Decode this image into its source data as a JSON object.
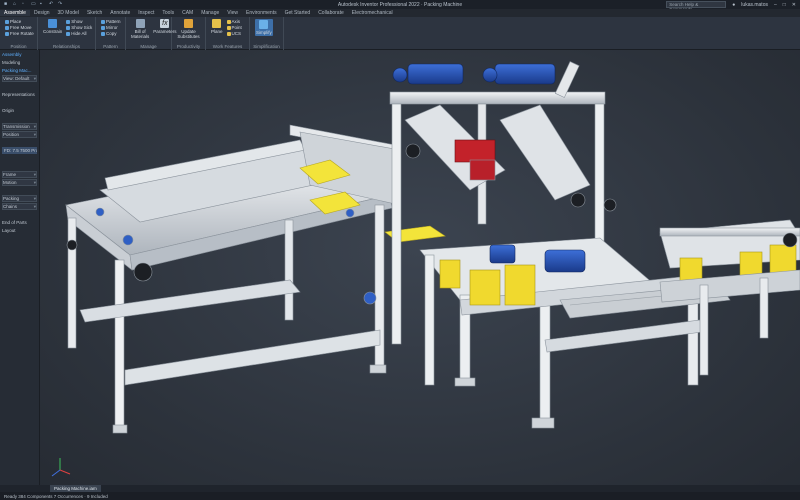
{
  "window": {
    "title": "Autodesk Inventor Professional 2022  ·  Packing Machine"
  },
  "search": {
    "placeholder": "Search Help & Commands..."
  },
  "user": {
    "name": "lukas.matos"
  },
  "tabs": [
    "Assemble",
    "Design",
    "3D Model",
    "Sketch",
    "Annotate",
    "Inspect",
    "Tools",
    "CAM",
    "Manage",
    "View",
    "Environments",
    "Get Started",
    "Collaborate",
    "Electromechanical"
  ],
  "ribbon": {
    "place": {
      "items": [
        "Place",
        "Free Move",
        "Free Rotate"
      ],
      "title": "Position"
    },
    "constrain": {
      "label": "Constrain",
      "items": [
        "Show",
        "Show Sick",
        "Hide All"
      ],
      "title": "Relationships"
    },
    "pattern": {
      "items": [
        "Pattern",
        "Mirror",
        "Copy"
      ],
      "title": "Pattern"
    },
    "manage": {
      "bom": "Bill of Materials",
      "params": "Parameters",
      "title": "Manage"
    },
    "productivity": {
      "substitutes": "Update Substitutes",
      "title": "Productivity"
    },
    "workfeatures": {
      "plane": "Plane",
      "items": [
        "Axis",
        "Point",
        "UCS"
      ],
      "title": "Work Features"
    },
    "simplification": {
      "simplify": "Simplify",
      "title": "Simplification"
    }
  },
  "browser": {
    "rows": [
      "Assembly",
      "Modeling",
      "Packing Mac...",
      "View: Default",
      "",
      "Representations",
      "",
      "Origin",
      "",
      "Transmission",
      "Position",
      "",
      "FD: 7.5 7500 Profil",
      "",
      "",
      "Frame",
      "Motion",
      "",
      "Packing",
      "Chains",
      "",
      "End of Parts",
      "Layout"
    ]
  },
  "doctab": {
    "label": "Packing Machine.iam"
  },
  "status": {
    "text": "Ready    384 Components    7 Occurrences · 9 Included"
  }
}
